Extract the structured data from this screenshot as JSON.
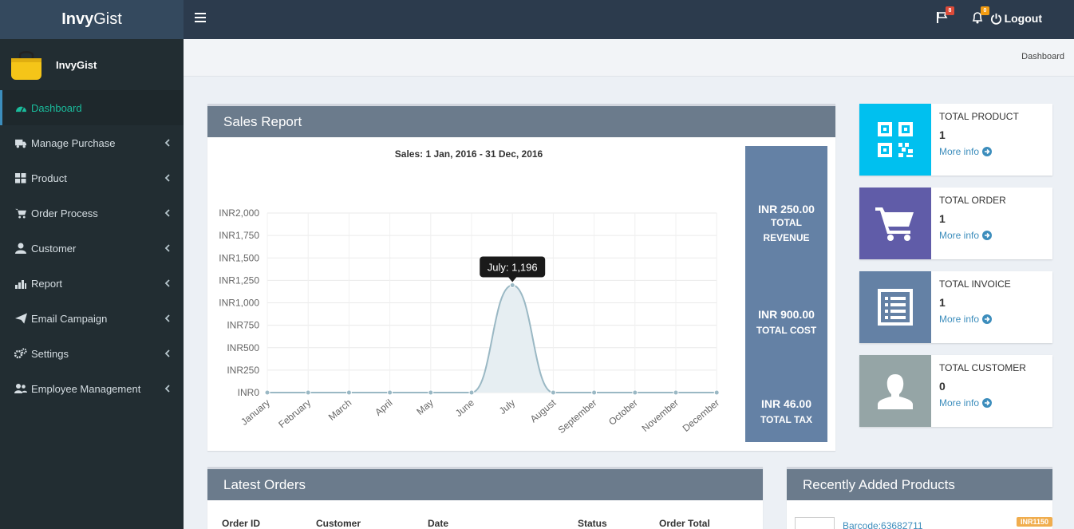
{
  "app": {
    "name_bold": "Invy",
    "name_rest": "Gist"
  },
  "header": {
    "flag_badge": "8",
    "bell_badge": "0",
    "logout_label": "Logout",
    "colors": {
      "flag_badge": "#dd4b39",
      "bell_badge": "#f39c12"
    }
  },
  "sidebar": {
    "user_name": "InvyGist",
    "items": [
      {
        "label": "Dashboard",
        "icon": "dashboard-icon",
        "active": true
      },
      {
        "label": "Manage Purchase",
        "icon": "truck-icon"
      },
      {
        "label": "Product",
        "icon": "grid-icon"
      },
      {
        "label": "Order Process",
        "icon": "cart-icon"
      },
      {
        "label": "Customer",
        "icon": "user-icon"
      },
      {
        "label": "Report",
        "icon": "bar-chart-icon"
      },
      {
        "label": "Email Campaign",
        "icon": "paper-plane-icon"
      },
      {
        "label": "Settings",
        "icon": "gears-icon"
      },
      {
        "label": "Employee Management",
        "icon": "users-icon"
      }
    ]
  },
  "breadcrumb": "Dashboard",
  "sales_report": {
    "title": "Sales Report",
    "revenue_amount": "INR 250.00",
    "revenue_label_1": "TOTAL",
    "revenue_label_2": "REVENUE",
    "cost_amount": "INR 900.00",
    "cost_label": "TOTAL COST",
    "tax_amount": "INR 46.00",
    "tax_label": "TOTAL TAX"
  },
  "chart_data": {
    "type": "line",
    "title": "Sales: 1 Jan, 2016 - 31 Dec, 2016",
    "categories": [
      "January",
      "February",
      "March",
      "April",
      "May",
      "June",
      "July",
      "August",
      "September",
      "October",
      "November",
      "December"
    ],
    "values": [
      0,
      0,
      0,
      0,
      0,
      0,
      1196,
      0,
      0,
      0,
      0,
      0
    ],
    "y_ticks": [
      "INR0",
      "INR250",
      "INR500",
      "INR750",
      "INR1,000",
      "INR1,250",
      "INR1,500",
      "INR1,750",
      "INR2,000"
    ],
    "ylim": [
      0,
      2000
    ],
    "tooltip": "July: 1,196",
    "grid": true,
    "colors": {
      "line": "#9ab8c4",
      "fill": "#e6eef2"
    }
  },
  "info_boxes": [
    {
      "title": "TOTAL PRODUCT",
      "value": "1",
      "more": "More info",
      "color": "#00c0ef",
      "icon": "qrcode-icon"
    },
    {
      "title": "TOTAL ORDER",
      "value": "1",
      "more": "More info",
      "color": "#605ca8",
      "icon": "shopping-cart-icon"
    },
    {
      "title": "TOTAL INVOICE",
      "value": "1",
      "more": "More info",
      "color": "#6481a5",
      "icon": "invoice-list-icon"
    },
    {
      "title": "TOTAL CUSTOMER",
      "value": "0",
      "more": "More info",
      "color": "#95a5a6",
      "icon": "person-icon"
    }
  ],
  "latest_orders": {
    "title": "Latest Orders",
    "columns": [
      "Order ID",
      "Customer",
      "Date",
      "Status",
      "Order Total"
    ]
  },
  "recent_products": {
    "title": "Recently Added Products",
    "items": [
      {
        "name": "Barcode:63682711",
        "price": "INR1150"
      }
    ]
  }
}
